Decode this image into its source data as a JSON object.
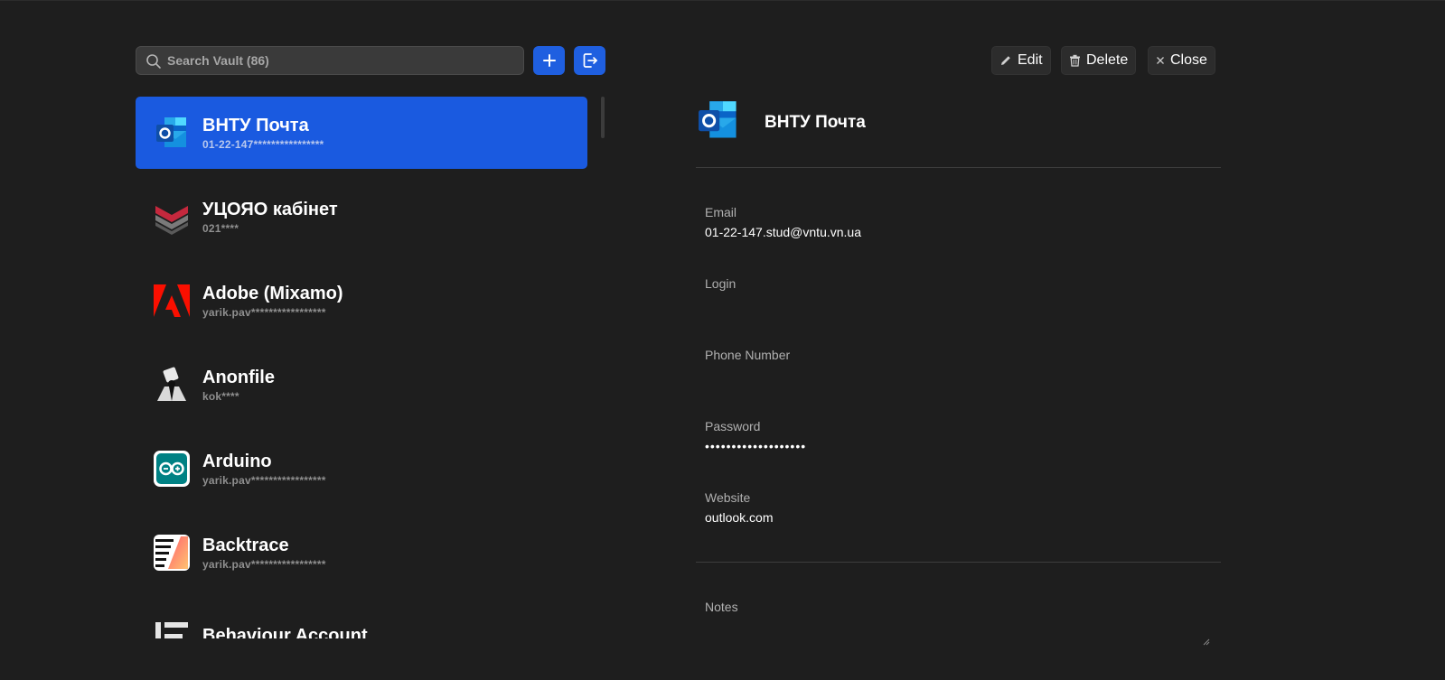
{
  "search": {
    "placeholder": "Search Vault (86)",
    "value": ""
  },
  "colors": {
    "accent": "#1a5ae0",
    "background": "#1e1e1e"
  },
  "toolbar": {
    "add_icon": "plus-icon",
    "logout_icon": "logout-icon",
    "edit_label": "Edit",
    "delete_label": "Delete",
    "close_label": "Close"
  },
  "vault_items": [
    {
      "name": "ВНТУ Почта",
      "sub": "01-22-147****************",
      "icon": "outlook-icon",
      "selected": true
    },
    {
      "name": "УЦОЯО кабінет",
      "sub": "021****",
      "icon": "ucoyao-icon",
      "selected": false
    },
    {
      "name": "Adobe (Mixamo)",
      "sub": "yarik.pav*****************",
      "icon": "adobe-icon",
      "selected": false
    },
    {
      "name": "Anonfile",
      "sub": "kok****",
      "icon": "anonfile-icon",
      "selected": false
    },
    {
      "name": "Arduino",
      "sub": "yarik.pav*****************",
      "icon": "arduino-icon",
      "selected": false
    },
    {
      "name": "Backtrace",
      "sub": "yarik.pav*****************",
      "icon": "backtrace-icon",
      "selected": false
    },
    {
      "name": "Behaviour Account",
      "sub": "",
      "icon": "behaviour-icon",
      "selected": false
    }
  ],
  "detail": {
    "title": "ВНТУ Почта",
    "icon": "outlook-icon",
    "fields": {
      "email": {
        "label": "Email",
        "value": "01-22-147.stud@vntu.vn.ua"
      },
      "login": {
        "label": "Login",
        "value": ""
      },
      "phone": {
        "label": "Phone Number",
        "value": ""
      },
      "password": {
        "label": "Password",
        "value": "•••••••••••••••••••"
      },
      "website": {
        "label": "Website",
        "value": "outlook.com"
      }
    },
    "notes": {
      "label": "Notes",
      "value": ""
    }
  }
}
